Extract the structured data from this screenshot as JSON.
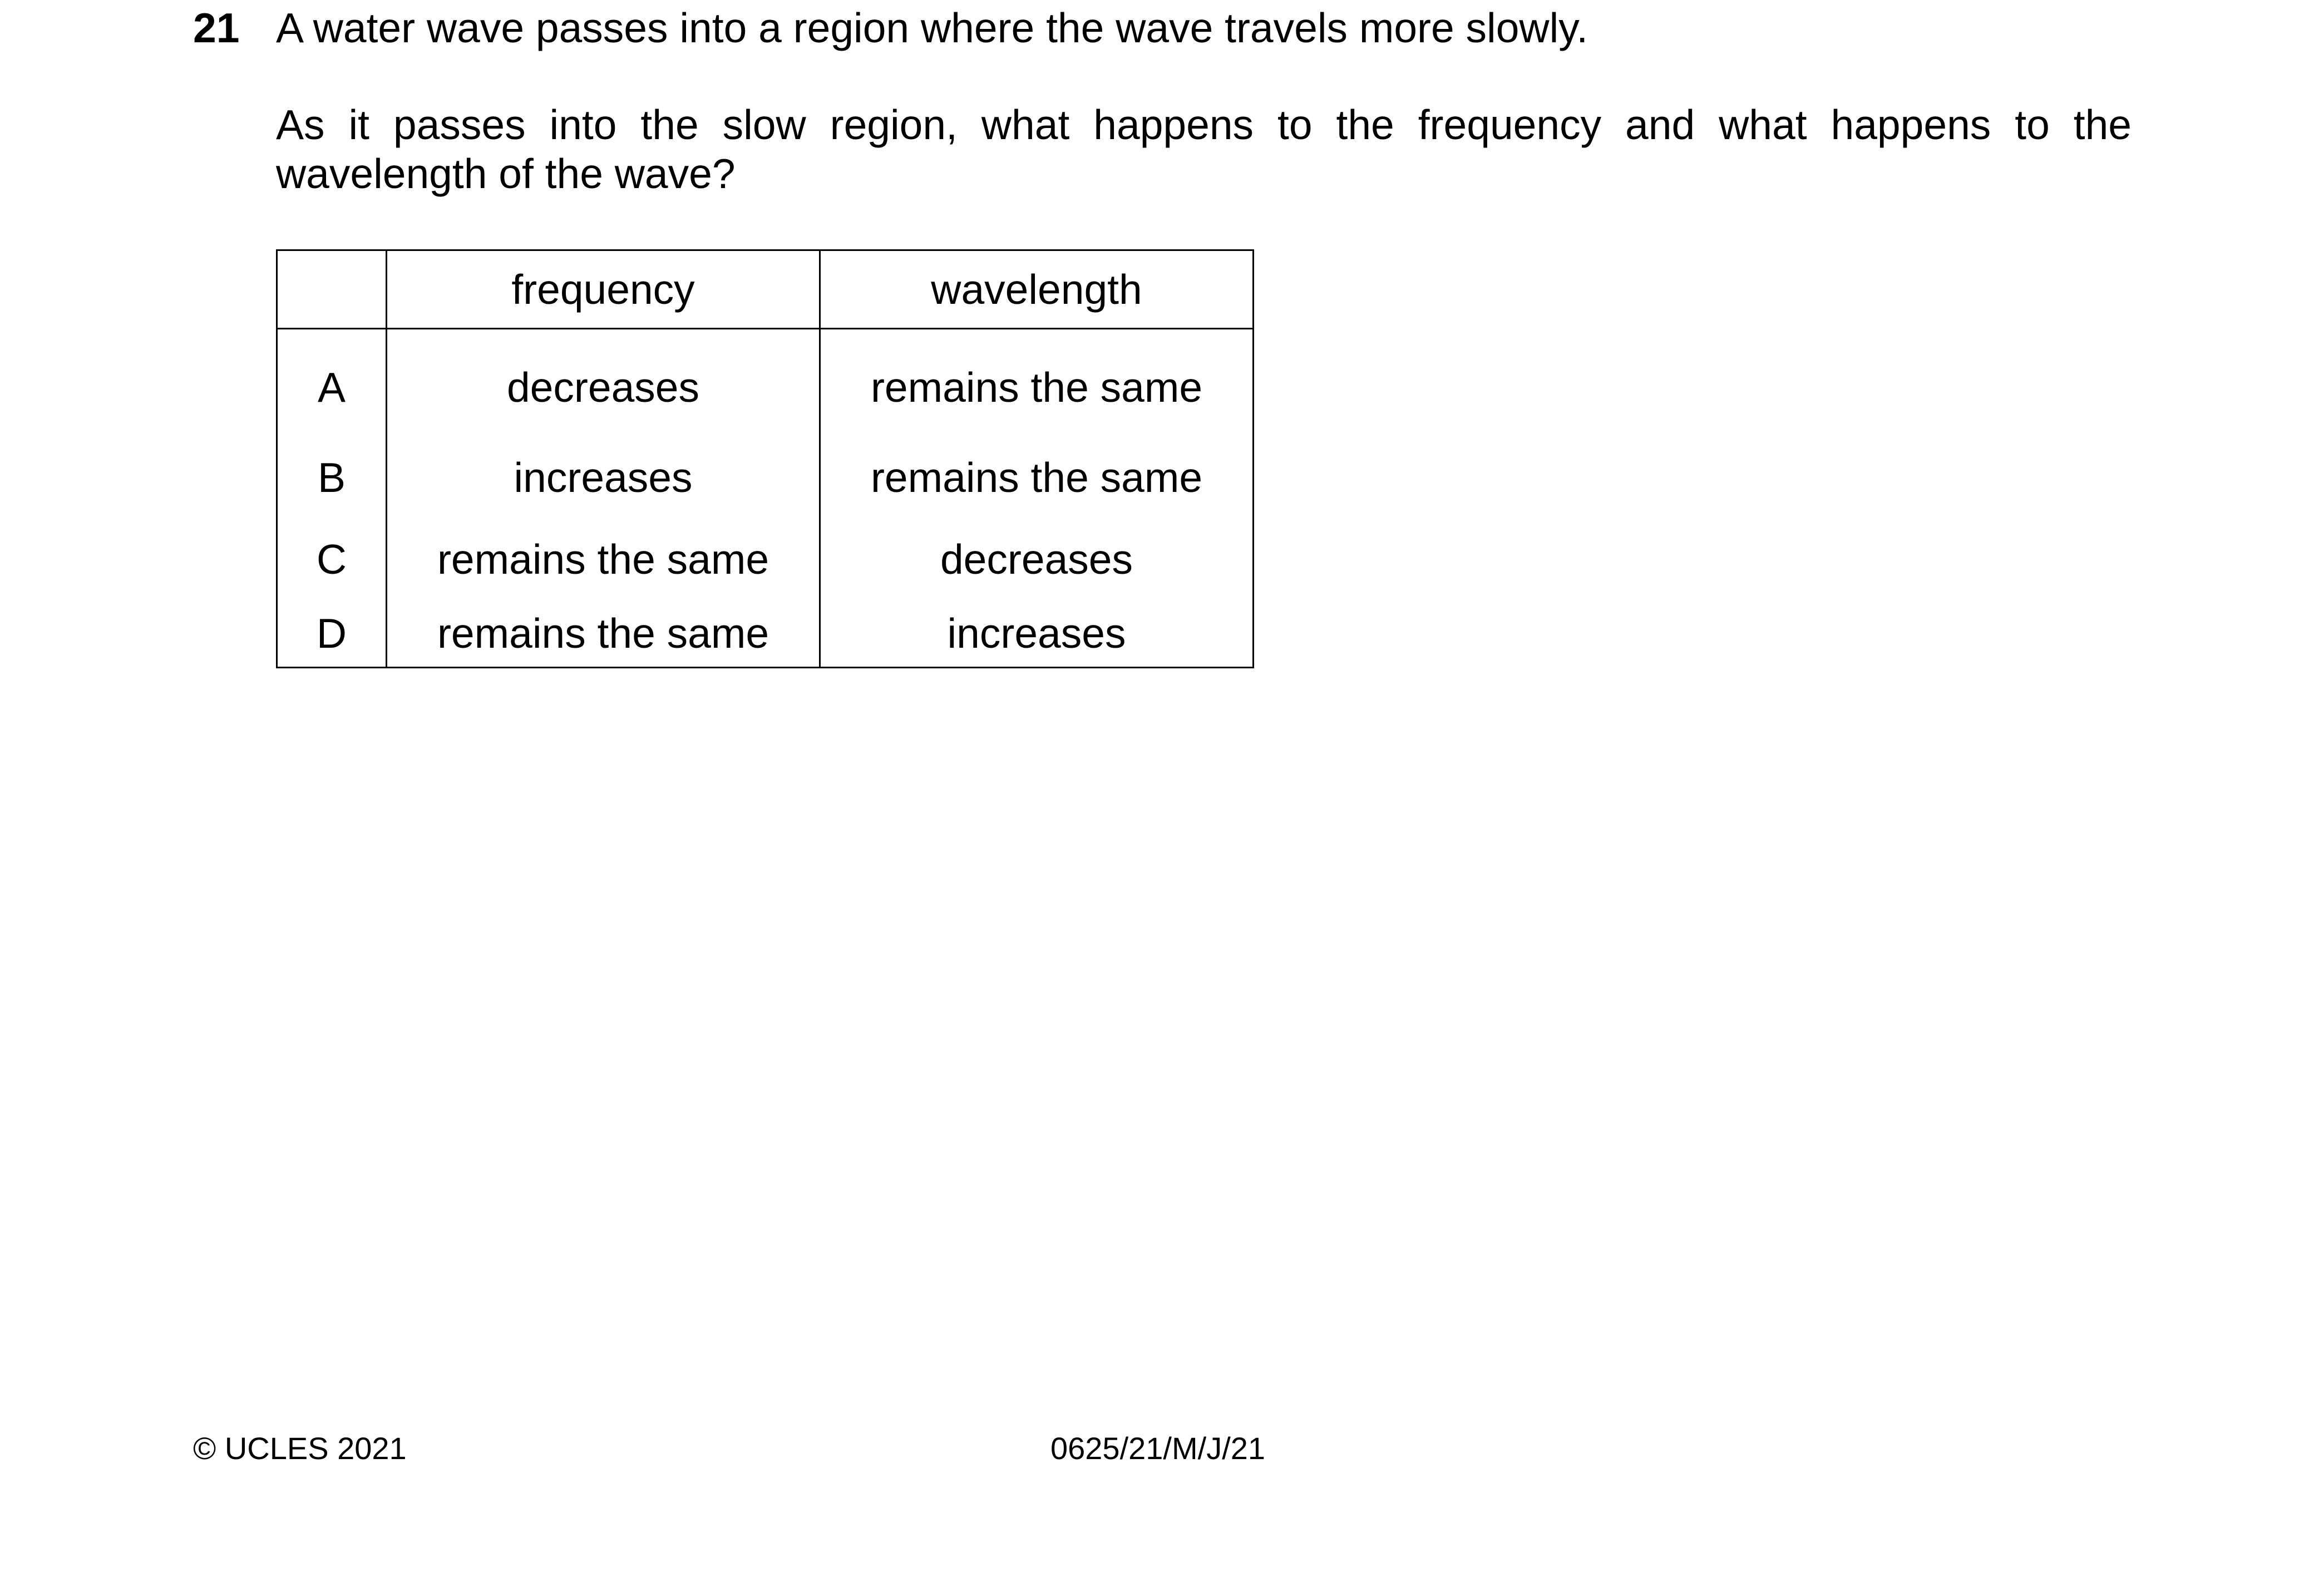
{
  "question": {
    "number": "21",
    "line1": "A water wave passes into a region where the wave travels more slowly.",
    "prompt": "As it passes into the slow region, what happens to the frequency and what happens to the wavelength of the wave?"
  },
  "table": {
    "headers": [
      "",
      "frequency",
      "wavelength"
    ],
    "rows": [
      {
        "key": "A",
        "frequency": "decreases",
        "wavelength": "remains the same"
      },
      {
        "key": "B",
        "frequency": "increases",
        "wavelength": "remains the same"
      },
      {
        "key": "C",
        "frequency": "remains the same",
        "wavelength": "decreases"
      },
      {
        "key": "D",
        "frequency": "remains the same",
        "wavelength": "increases"
      }
    ]
  },
  "footer": {
    "copyright": "© UCLES 2021",
    "code": "0625/21/M/J/21"
  }
}
